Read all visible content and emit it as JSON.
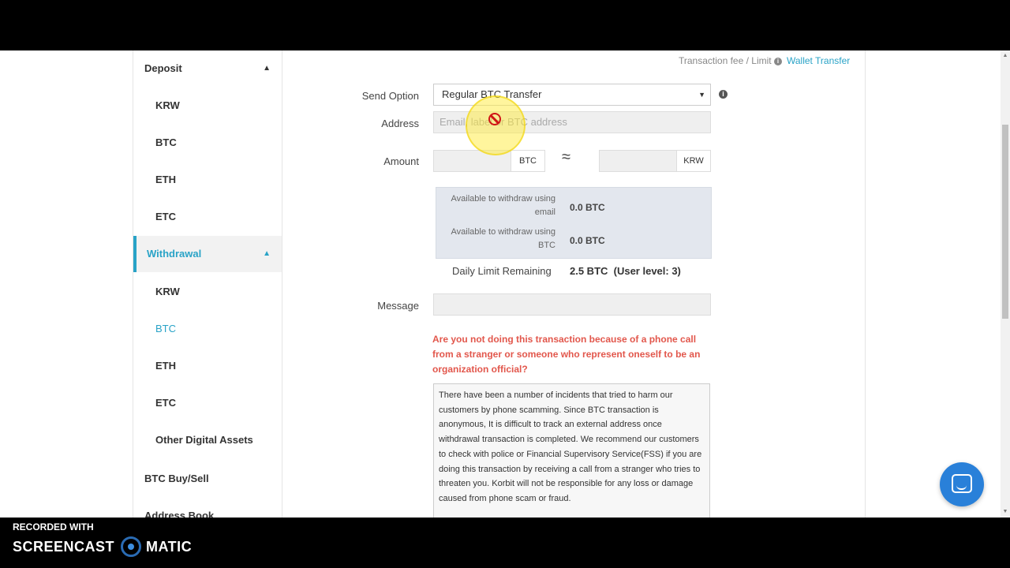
{
  "sidebar": {
    "deposit": {
      "label": "Deposit",
      "items": [
        "KRW",
        "BTC",
        "ETH",
        "ETC"
      ]
    },
    "withdrawal": {
      "label": "Withdrawal",
      "items": [
        "KRW",
        "BTC",
        "ETH",
        "ETC",
        "Other Digital Assets"
      ],
      "active_item": "BTC"
    },
    "btc_buy_sell": "BTC Buy/Sell",
    "address_book": "Address Book"
  },
  "header_links": {
    "fee_limit": "Transaction fee / Limit",
    "wallet_transfer": "Wallet Transfer"
  },
  "form": {
    "send_option_label": "Send Option",
    "send_option_value": "Regular BTC Transfer",
    "address_label": "Address",
    "address_placeholder": "Email, label or BTC address",
    "amount_label": "Amount",
    "amount_unit_btc": "BTC",
    "approx_symbol": "≈",
    "amount_unit_krw": "KRW",
    "avail_email_label": "Available to withdraw using email",
    "avail_email_value": "0.0 BTC",
    "avail_btc_label": "Available to withdraw using BTC",
    "avail_btc_value": "0.0 BTC",
    "daily_limit_label": "Daily Limit Remaining",
    "daily_limit_value": "2.5 BTC  (User level: 3)",
    "message_label": "Message"
  },
  "warning": "Are you not doing this transaction because of a phone call from a stranger or someone who represent oneself to be an organization official?",
  "notice": "There have been a number of incidents that tried to harm our customers by phone scamming. Since BTC transaction is anonymous, It is difficult to track an external address once withdrawal transaction is completed. We recommend our customers to check with police or Financial Supervisory Service(FSS) if you are doing this transaction by receiving a call from a stranger who tries to threaten you. Korbit will not be responsible for any loss or damage caused from phone scam or fraud.",
  "recorder": {
    "small": "RECORDED WITH",
    "left": "SCREENCAST",
    "right": "MATIC"
  },
  "colors": {
    "accent": "#29a3c7",
    "warning": "#e2574c",
    "chat": "#2980d9"
  }
}
